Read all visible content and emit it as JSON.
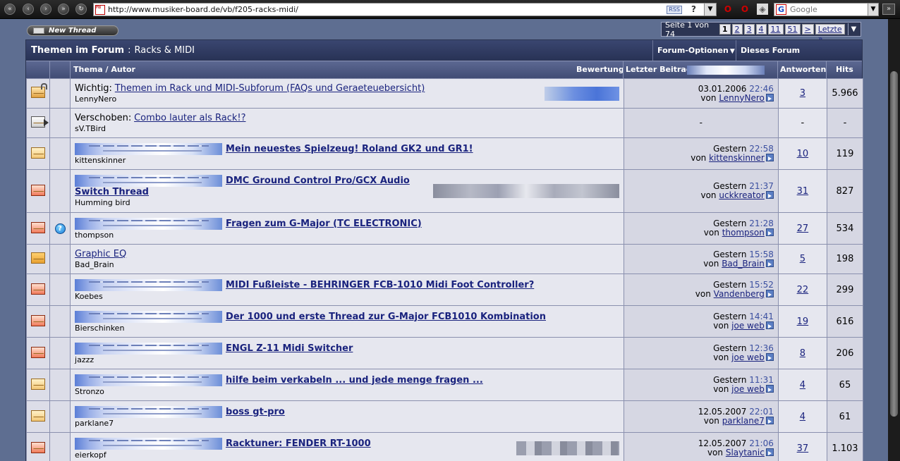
{
  "browser": {
    "url": "http://www.musiker-board.de/vb/f205-racks-midi/",
    "rss_label": "RSS",
    "help_label": "?",
    "search_placeholder": "Google"
  },
  "forum": {
    "new_thread_label": "New Thread",
    "title": "Themen im Forum",
    "separator": ":",
    "name": "Racks & MIDI",
    "options_label": "Forum-Optionen",
    "search_label": "Dieses Forum durchsuchen",
    "pagenav": {
      "info": "Seite 1 von 74",
      "pages": [
        "1",
        "2",
        "3",
        "4",
        "11",
        "51",
        ">",
        "Letzte »"
      ],
      "current": "1"
    },
    "columns": {
      "title": "Thema / Autor",
      "rating": "Bewertung",
      "last_post": "Letzter Beitrag",
      "replies": "Antworten",
      "hits": "Hits"
    }
  },
  "threads": [
    {
      "icon": "sticky-locked",
      "post_icon": "",
      "prefix": "Wichtig:",
      "title": "Themen im Rack und MIDI-Subforum (FAQs und Geraeteuebersicht)",
      "bold": false,
      "banner": false,
      "author": "LennyNero",
      "rating": "blue",
      "date": "03.01.2006",
      "time": "22:46",
      "by": "von",
      "last_user": "LennyNero",
      "replies": "3",
      "hits": "5.966"
    },
    {
      "icon": "moved",
      "post_icon": "",
      "prefix": "Verschoben:",
      "title": "Combo lauter als Rack!?",
      "bold": false,
      "banner": false,
      "author": "sV.TBird",
      "rating": "",
      "date": "",
      "time": "",
      "by": "",
      "last_user": "",
      "moved_dash": "-",
      "replies": "-",
      "hits": "-"
    },
    {
      "icon": "normal",
      "post_icon": "",
      "prefix": "",
      "title": "Mein neuestes Spielzeug! Roland GK2 und GR1!",
      "bold": true,
      "banner": true,
      "author": "kittenskinner",
      "rating": "",
      "date": "Gestern",
      "time": "22:58",
      "by": "von",
      "last_user": "kittenskinner",
      "replies": "10",
      "hits": "119"
    },
    {
      "icon": "hot",
      "post_icon": "",
      "prefix": "",
      "title": "DMC Ground Control Pro/GCX Audio",
      "title2": "Switch Thread",
      "bold": true,
      "banner": true,
      "author": "Humming bird",
      "rating": "gray",
      "date": "Gestern",
      "time": "21:37",
      "by": "von",
      "last_user": "uckkreator",
      "replies": "31",
      "hits": "827"
    },
    {
      "icon": "hot",
      "post_icon": "question",
      "prefix": "",
      "title": "Fragen zum G-Major (TC ELECTRONIC)",
      "bold": true,
      "banner": true,
      "author": "thompson",
      "rating": "",
      "date": "Gestern",
      "time": "21:28",
      "by": "von",
      "last_user": "thompson",
      "replies": "27",
      "hits": "534"
    },
    {
      "icon": "normal-new",
      "post_icon": "",
      "prefix": "",
      "title": "Graphic EQ",
      "bold": false,
      "banner": false,
      "author": "Bad_Brain",
      "rating": "",
      "date": "Gestern",
      "time": "15:58",
      "by": "von",
      "last_user": "Bad_Brain",
      "replies": "5",
      "hits": "198"
    },
    {
      "icon": "hot",
      "post_icon": "",
      "prefix": "",
      "title": "MIDI Fußleiste - BEHRINGER FCB-1010 Midi Foot Controller?",
      "bold": true,
      "banner": true,
      "author": "Koebes",
      "rating": "",
      "date": "Gestern",
      "time": "15:52",
      "by": "von",
      "last_user": "Vandenberg",
      "replies": "22",
      "hits": "299"
    },
    {
      "icon": "hot",
      "post_icon": "",
      "prefix": "",
      "title": "Der 1000 und erste Thread zur G-Major FCB1010 Kombination",
      "bold": true,
      "banner": true,
      "author": "Bierschinken",
      "rating": "",
      "date": "Gestern",
      "time": "14:41",
      "by": "von",
      "last_user": "joe web",
      "replies": "19",
      "hits": "616"
    },
    {
      "icon": "hot",
      "post_icon": "",
      "prefix": "",
      "title": "ENGL Z-11 Midi Switcher",
      "bold": true,
      "banner": true,
      "author": "jazzz",
      "rating": "",
      "date": "Gestern",
      "time": "12:36",
      "by": "von",
      "last_user": "joe web",
      "replies": "8",
      "hits": "206"
    },
    {
      "icon": "normal",
      "post_icon": "",
      "prefix": "",
      "title": "hilfe beim verkabeln ... und jede menge fragen ...",
      "bold": true,
      "banner": true,
      "author": "Stronzo",
      "rating": "",
      "date": "Gestern",
      "time": "11:31",
      "by": "von",
      "last_user": "joe web",
      "replies": "4",
      "hits": "65"
    },
    {
      "icon": "normal",
      "post_icon": "",
      "prefix": "",
      "title": "boss gt-pro",
      "bold": true,
      "banner": true,
      "author": "parklane7",
      "rating": "",
      "date": "12.05.2007",
      "time": "22:01",
      "by": "von",
      "last_user": "parklane7",
      "replies": "4",
      "hits": "61"
    },
    {
      "icon": "hot",
      "post_icon": "",
      "prefix": "",
      "title": "Racktuner: FENDER RT-1000",
      "bold": true,
      "banner": true,
      "author": "eierkopf",
      "rating": "gray2",
      "date": "12.05.2007",
      "time": "21:06",
      "by": "von",
      "last_user": "Slaytanic",
      "replies": "37",
      "hits": "1.103"
    }
  ]
}
